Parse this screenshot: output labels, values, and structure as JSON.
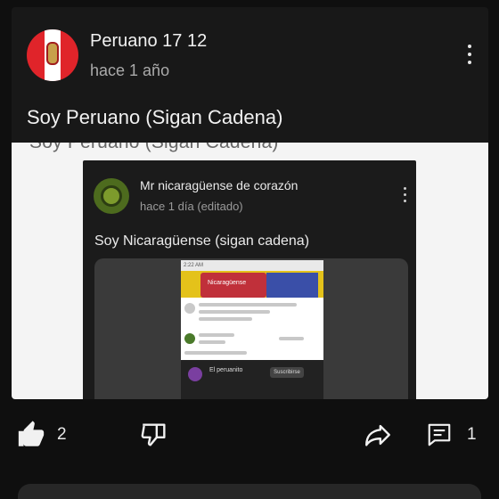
{
  "post": {
    "author": "Peruano 17 12",
    "time": "hace 1 año",
    "text": "Soy Peruano (Sigan Cadena)"
  },
  "attachment": {
    "cut_text": "Soy Peruano (Sigan Cadena)",
    "inner_post": {
      "author": "Mr nicaragüense de corazón",
      "time": "hace 1 día (editado)",
      "text": "Soy Nicaragüense (sigan cadena)"
    },
    "phone": {
      "status": "2:22 AM",
      "banner_caption": "Nicaragüense",
      "bottom_name": "El peruanito",
      "bottom_button": "Suscribirse"
    }
  },
  "actions": {
    "like_count": "2",
    "comment_count": "1"
  },
  "colors": {
    "background": "#0f0f0f",
    "card": "#181818",
    "text": "#f1f1f1",
    "muted": "#aaaaaa"
  },
  "icons": [
    "like-icon",
    "dislike-icon",
    "share-icon",
    "comment-icon",
    "more-vert-icon"
  ]
}
